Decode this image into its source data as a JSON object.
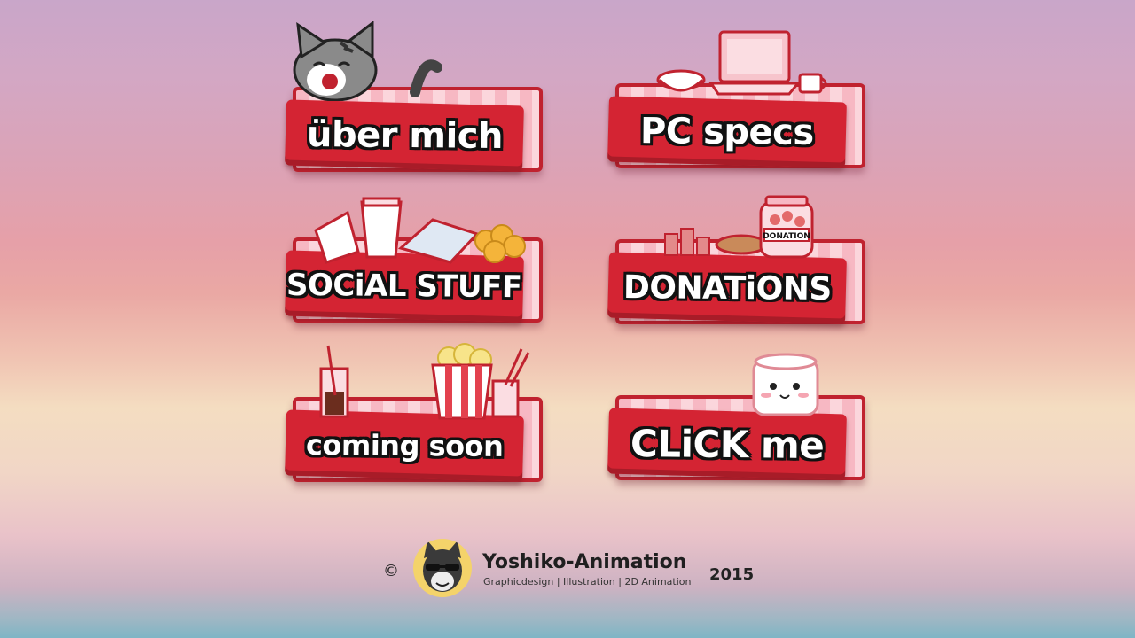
{
  "buttons": [
    {
      "label": "über mich",
      "icon": "cat-icon"
    },
    {
      "label": "PC specs",
      "icon": "laptop-icon"
    },
    {
      "label": "SOCiAL STUFF",
      "icon": "snacks-icon"
    },
    {
      "label": "DONATiONS",
      "icon": "donation-jar-icon"
    },
    {
      "label": "coming soon",
      "icon": "popcorn-icon"
    },
    {
      "label": "CLiCK me",
      "icon": "marshmallow-icon"
    }
  ],
  "jar_label": "DONATION",
  "footer": {
    "copyright": "©",
    "brand": "Yoshiko-Animation",
    "tagline": "Graphicdesign | Illustration | 2D Animation",
    "year": "2015"
  },
  "colors": {
    "accent_red": "#d42433",
    "stripe_pink": "#f7b8c3",
    "stripe_light": "#fbd6dc",
    "outline": "#111111"
  }
}
